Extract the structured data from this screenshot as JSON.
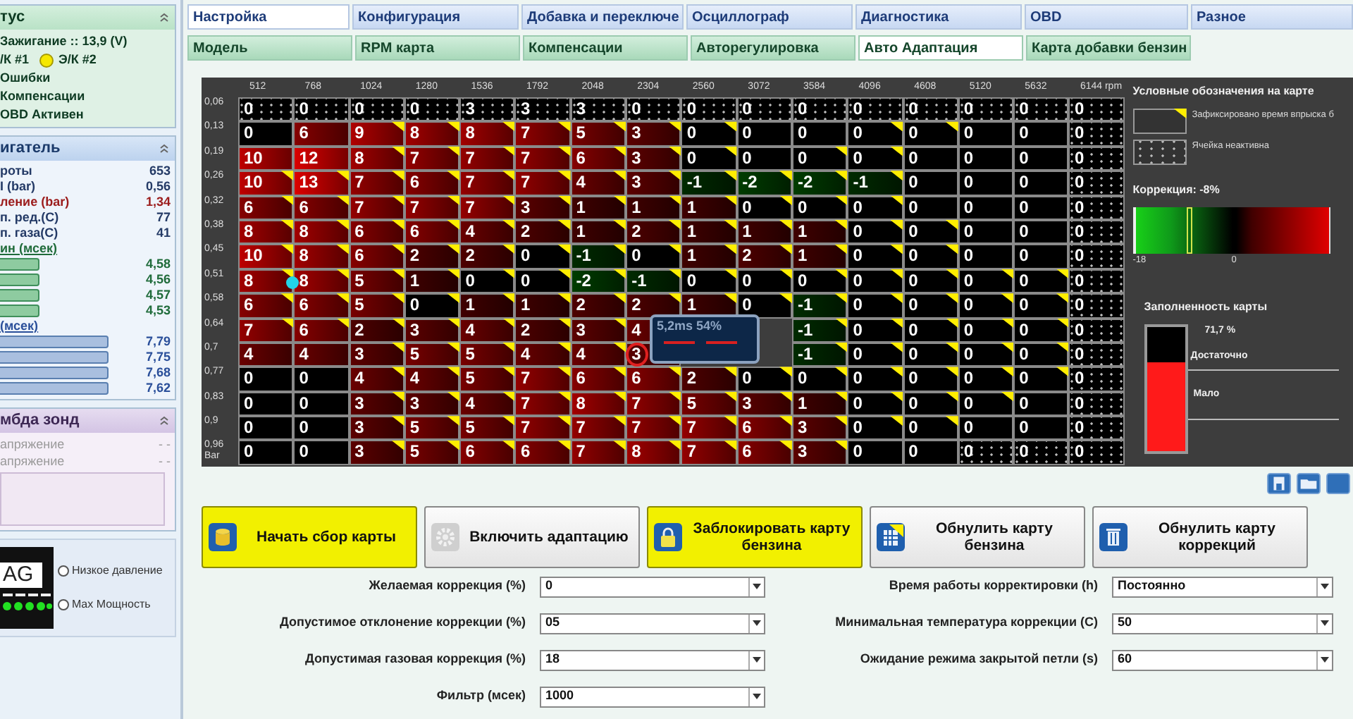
{
  "status_panel": {
    "title": "тус",
    "ignition": "Зажигание :: 13,9 (V)",
    "injectors": [
      {
        "label": "/К #1",
        "lit": false
      },
      {
        "label": "Э/К #2",
        "lit": true
      }
    ],
    "items": [
      "Ошибки",
      "Компенсации",
      "OBD Активен"
    ]
  },
  "engine_panel": {
    "title": "игатель",
    "readings": [
      {
        "label": "роты",
        "value": "653",
        "kind": "plain"
      },
      {
        "label": "I (bar)",
        "value": "0,56",
        "kind": "plain"
      },
      {
        "label": "ление (bar)",
        "value": "1,34",
        "kind": "alert"
      },
      {
        "label": "п. ред.(C)",
        "value": "77",
        "kind": "plain"
      },
      {
        "label": "п. газа(C)",
        "value": "41",
        "kind": "plain"
      }
    ],
    "gas_injection": {
      "title": "ин (мсек)",
      "values": [
        "4,58",
        "4,56",
        "4,57",
        "4,53"
      ]
    },
    "petrol_injection": {
      "title": "(мсек)",
      "values": [
        "7,79",
        "7,75",
        "7,68",
        "7,62"
      ]
    }
  },
  "lambda_panel": {
    "title": "мбда зонд",
    "rows": [
      {
        "label": "апряжение",
        "value": "- -"
      },
      {
        "label": "апряжение",
        "value": "- -"
      }
    ]
  },
  "gas_panel": {
    "logo": "AG",
    "options": [
      {
        "label": "Низкое давление",
        "selected": false
      },
      {
        "label": "Max Мощность",
        "selected": false
      }
    ]
  },
  "tabs": [
    {
      "label": "Настройка",
      "selected": true
    },
    {
      "label": "Конфигурация",
      "selected": false
    },
    {
      "label": "Добавка и переключе",
      "selected": false
    },
    {
      "label": "Осциллограф",
      "selected": false
    },
    {
      "label": "Диагностика",
      "selected": false
    },
    {
      "label": "OBD",
      "selected": false
    },
    {
      "label": "Разное",
      "selected": false
    }
  ],
  "subtabs": [
    {
      "label": "Модель",
      "selected": false
    },
    {
      "label": "RPM карта",
      "selected": false
    },
    {
      "label": "Компенсации",
      "selected": false
    },
    {
      "label": "Авторегулировка",
      "selected": false
    },
    {
      "label": "Авто Адаптация",
      "selected": true
    },
    {
      "label": "Карта добавки бензин",
      "selected": false
    }
  ],
  "map": {
    "columns": [
      "512",
      "768",
      "1024",
      "1280",
      "1536",
      "1792",
      "2048",
      "2304",
      "2560",
      "3072",
      "3584",
      "4096",
      "4608",
      "5120",
      "5632",
      "6144 rpm"
    ],
    "row_unit": "Bar",
    "rows": [
      {
        "label": "0,06",
        "cells": [
          {
            "kind": "inactive",
            "value": "0",
            "flagged": false
          },
          {
            "kind": "inactive",
            "value": "0",
            "flagged": false
          },
          {
            "kind": "inactive",
            "value": "0",
            "flagged": false
          },
          {
            "kind": "inactive",
            "value": "0",
            "flagged": false
          },
          {
            "kind": "inactive",
            "value": "3",
            "flagged": false
          },
          {
            "kind": "inactive",
            "value": "3",
            "flagged": false
          },
          {
            "kind": "inactive",
            "value": "3",
            "flagged": false
          },
          {
            "kind": "inactive",
            "value": "0",
            "flagged": false
          },
          {
            "kind": "inactive",
            "value": "0",
            "flagged": false
          },
          {
            "kind": "inactive",
            "value": "0",
            "flagged": false
          },
          {
            "kind": "inactive",
            "value": "0",
            "flagged": false
          },
          {
            "kind": "inactive",
            "value": "0",
            "flagged": false
          },
          {
            "kind": "inactive",
            "value": "0",
            "flagged": false
          },
          {
            "kind": "inactive",
            "value": "0",
            "flagged": false
          },
          {
            "kind": "inactive",
            "value": "0",
            "flagged": false
          },
          {
            "kind": "inactive",
            "value": "0",
            "flagged": false
          }
        ]
      },
      {
        "label": "0,13",
        "cells": [
          {
            "kind": "active",
            "value": "0",
            "flagged": false
          },
          {
            "kind": "active",
            "value": "6",
            "flagged": false
          },
          {
            "kind": "active",
            "value": "9",
            "flagged": true
          },
          {
            "kind": "active",
            "value": "8",
            "flagged": true
          },
          {
            "kind": "active",
            "value": "8",
            "flagged": true
          },
          {
            "kind": "active",
            "value": "7",
            "flagged": true
          },
          {
            "kind": "active",
            "value": "5",
            "flagged": true
          },
          {
            "kind": "active",
            "value": "3",
            "flagged": true
          },
          {
            "kind": "active",
            "value": "0",
            "flagged": true
          },
          {
            "kind": "active",
            "value": "0",
            "flagged": false
          },
          {
            "kind": "active",
            "value": "0",
            "flagged": false
          },
          {
            "kind": "active",
            "value": "0",
            "flagged": true
          },
          {
            "kind": "active",
            "value": "0",
            "flagged": true
          },
          {
            "kind": "active",
            "value": "0",
            "flagged": false
          },
          {
            "kind": "active",
            "value": "0",
            "flagged": false
          },
          {
            "kind": "inactive",
            "value": "0",
            "flagged": false
          }
        ]
      },
      {
        "label": "0,19",
        "cells": [
          {
            "kind": "active",
            "value": "10",
            "flagged": false
          },
          {
            "kind": "active",
            "value": "12",
            "flagged": false
          },
          {
            "kind": "active",
            "value": "8",
            "flagged": true
          },
          {
            "kind": "active",
            "value": "7",
            "flagged": true
          },
          {
            "kind": "active",
            "value": "7",
            "flagged": true
          },
          {
            "kind": "active",
            "value": "7",
            "flagged": true
          },
          {
            "kind": "active",
            "value": "6",
            "flagged": true
          },
          {
            "kind": "active",
            "value": "3",
            "flagged": true
          },
          {
            "kind": "active",
            "value": "0",
            "flagged": true
          },
          {
            "kind": "active",
            "value": "0",
            "flagged": false
          },
          {
            "kind": "active",
            "value": "0",
            "flagged": true
          },
          {
            "kind": "active",
            "value": "0",
            "flagged": true
          },
          {
            "kind": "active",
            "value": "0",
            "flagged": false
          },
          {
            "kind": "active",
            "value": "0",
            "flagged": false
          },
          {
            "kind": "active",
            "value": "0",
            "flagged": false
          },
          {
            "kind": "inactive",
            "value": "0",
            "flagged": false
          }
        ]
      },
      {
        "label": "0,26",
        "cells": [
          {
            "kind": "active",
            "value": "10",
            "flagged": true
          },
          {
            "kind": "active",
            "value": "13",
            "flagged": true
          },
          {
            "kind": "active",
            "value": "7",
            "flagged": true
          },
          {
            "kind": "active",
            "value": "6",
            "flagged": true
          },
          {
            "kind": "active",
            "value": "7",
            "flagged": true
          },
          {
            "kind": "active",
            "value": "7",
            "flagged": true
          },
          {
            "kind": "active",
            "value": "4",
            "flagged": true
          },
          {
            "kind": "active",
            "value": "3",
            "flagged": true
          },
          {
            "kind": "active",
            "value": "-1",
            "flagged": true
          },
          {
            "kind": "active",
            "value": "-2",
            "flagged": true
          },
          {
            "kind": "active",
            "value": "-2",
            "flagged": true
          },
          {
            "kind": "active",
            "value": "-1",
            "flagged": true
          },
          {
            "kind": "active",
            "value": "0",
            "flagged": false
          },
          {
            "kind": "active",
            "value": "0",
            "flagged": false
          },
          {
            "kind": "active",
            "value": "0",
            "flagged": false
          },
          {
            "kind": "inactive",
            "value": "0",
            "flagged": false
          }
        ]
      },
      {
        "label": "0,32",
        "cells": [
          {
            "kind": "active",
            "value": "6",
            "flagged": true
          },
          {
            "kind": "active",
            "value": "6",
            "flagged": true
          },
          {
            "kind": "active",
            "value": "7",
            "flagged": true
          },
          {
            "kind": "active",
            "value": "7",
            "flagged": true
          },
          {
            "kind": "active",
            "value": "7",
            "flagged": true
          },
          {
            "kind": "active",
            "value": "3",
            "flagged": true
          },
          {
            "kind": "active",
            "value": "1",
            "flagged": true
          },
          {
            "kind": "active",
            "value": "1",
            "flagged": true
          },
          {
            "kind": "active",
            "value": "1",
            "flagged": true
          },
          {
            "kind": "active",
            "value": "0",
            "flagged": true
          },
          {
            "kind": "active",
            "value": "0",
            "flagged": true
          },
          {
            "kind": "active",
            "value": "0",
            "flagged": true
          },
          {
            "kind": "active",
            "value": "0",
            "flagged": false
          },
          {
            "kind": "active",
            "value": "0",
            "flagged": false
          },
          {
            "kind": "active",
            "value": "0",
            "flagged": false
          },
          {
            "kind": "inactive",
            "value": "0",
            "flagged": false
          }
        ]
      },
      {
        "label": "0,38",
        "cells": [
          {
            "kind": "active",
            "value": "8",
            "flagged": true
          },
          {
            "kind": "active",
            "value": "8",
            "flagged": true
          },
          {
            "kind": "active",
            "value": "6",
            "flagged": true
          },
          {
            "kind": "active",
            "value": "6",
            "flagged": true
          },
          {
            "kind": "active",
            "value": "4",
            "flagged": true
          },
          {
            "kind": "active",
            "value": "2",
            "flagged": true
          },
          {
            "kind": "active",
            "value": "1",
            "flagged": true
          },
          {
            "kind": "active",
            "value": "2",
            "flagged": true
          },
          {
            "kind": "active",
            "value": "1",
            "flagged": true
          },
          {
            "kind": "active",
            "value": "1",
            "flagged": true
          },
          {
            "kind": "active",
            "value": "1",
            "flagged": true
          },
          {
            "kind": "active",
            "value": "0",
            "flagged": true
          },
          {
            "kind": "active",
            "value": "0",
            "flagged": true
          },
          {
            "kind": "active",
            "value": "0",
            "flagged": false
          },
          {
            "kind": "active",
            "value": "0",
            "flagged": false
          },
          {
            "kind": "inactive",
            "value": "0",
            "flagged": false
          }
        ]
      },
      {
        "label": "0,45",
        "cells": [
          {
            "kind": "active",
            "value": "10",
            "flagged": true
          },
          {
            "kind": "active",
            "value": "8",
            "flagged": true
          },
          {
            "kind": "active",
            "value": "6",
            "flagged": true
          },
          {
            "kind": "active",
            "value": "2",
            "flagged": true
          },
          {
            "kind": "active",
            "value": "2",
            "flagged": true
          },
          {
            "kind": "active",
            "value": "0",
            "flagged": true
          },
          {
            "kind": "active",
            "value": "-1",
            "flagged": true
          },
          {
            "kind": "active",
            "value": "0",
            "flagged": true
          },
          {
            "kind": "active",
            "value": "1",
            "flagged": true
          },
          {
            "kind": "active",
            "value": "2",
            "flagged": true
          },
          {
            "kind": "active",
            "value": "1",
            "flagged": true
          },
          {
            "kind": "active",
            "value": "0",
            "flagged": true
          },
          {
            "kind": "active",
            "value": "0",
            "flagged": true
          },
          {
            "kind": "active",
            "value": "0",
            "flagged": false
          },
          {
            "kind": "active",
            "value": "0",
            "flagged": false
          },
          {
            "kind": "inactive",
            "value": "0",
            "flagged": false
          }
        ]
      },
      {
        "label": "0,51",
        "cells": [
          {
            "kind": "dotted",
            "value": "8",
            "flagged": true
          },
          {
            "kind": "active",
            "value": "8",
            "flagged": true
          },
          {
            "kind": "active",
            "value": "5",
            "flagged": true
          },
          {
            "kind": "active",
            "value": "1",
            "flagged": true
          },
          {
            "kind": "active",
            "value": "0",
            "flagged": true
          },
          {
            "kind": "active",
            "value": "0",
            "flagged": true
          },
          {
            "kind": "active",
            "value": "-2",
            "flagged": true
          },
          {
            "kind": "active",
            "value": "-1",
            "flagged": true
          },
          {
            "kind": "active",
            "value": "0",
            "flagged": true
          },
          {
            "kind": "active",
            "value": "0",
            "flagged": true
          },
          {
            "kind": "active",
            "value": "0",
            "flagged": true
          },
          {
            "kind": "active",
            "value": "0",
            "flagged": true
          },
          {
            "kind": "active",
            "value": "0",
            "flagged": true
          },
          {
            "kind": "active",
            "value": "0",
            "flagged": true
          },
          {
            "kind": "active",
            "value": "0",
            "flagged": true
          },
          {
            "kind": "inactive",
            "value": "0",
            "flagged": false
          }
        ]
      },
      {
        "label": "0,58",
        "cells": [
          {
            "kind": "active",
            "value": "6",
            "flagged": true
          },
          {
            "kind": "active",
            "value": "6",
            "flagged": true
          },
          {
            "kind": "active",
            "value": "5",
            "flagged": true
          },
          {
            "kind": "active",
            "value": "0",
            "flagged": true
          },
          {
            "kind": "active",
            "value": "1",
            "flagged": true
          },
          {
            "kind": "active",
            "value": "1",
            "flagged": true
          },
          {
            "kind": "active",
            "value": "2",
            "flagged": true
          },
          {
            "kind": "active",
            "value": "2",
            "flagged": true
          },
          {
            "kind": "active",
            "value": "1",
            "flagged": true
          },
          {
            "kind": "active",
            "value": "0",
            "flagged": true
          },
          {
            "kind": "active",
            "value": "-1",
            "flagged": true
          },
          {
            "kind": "active",
            "value": "0",
            "flagged": true
          },
          {
            "kind": "active",
            "value": "0",
            "flagged": true
          },
          {
            "kind": "active",
            "value": "0",
            "flagged": true
          },
          {
            "kind": "active",
            "value": "0",
            "flagged": true
          },
          {
            "kind": "inactive",
            "value": "0",
            "flagged": false
          }
        ]
      },
      {
        "label": "0,64",
        "cells": [
          {
            "kind": "active",
            "value": "7",
            "flagged": true
          },
          {
            "kind": "active",
            "value": "6",
            "flagged": true
          },
          {
            "kind": "active",
            "value": "2",
            "flagged": true
          },
          {
            "kind": "active",
            "value": "3",
            "flagged": true
          },
          {
            "kind": "active",
            "value": "4",
            "flagged": true
          },
          {
            "kind": "active",
            "value": "2",
            "flagged": true
          },
          {
            "kind": "active",
            "value": "3",
            "flagged": true
          },
          {
            "kind": "active",
            "value": "4",
            "flagged": false
          },
          {
            "kind": "covered"
          },
          {
            "kind": "covered"
          },
          {
            "kind": "active",
            "value": "-1",
            "flagged": true
          },
          {
            "kind": "active",
            "value": "0",
            "flagged": true
          },
          {
            "kind": "active",
            "value": "0",
            "flagged": true
          },
          {
            "kind": "active",
            "value": "0",
            "flagged": true
          },
          {
            "kind": "active",
            "value": "0",
            "flagged": true
          },
          {
            "kind": "inactive",
            "value": "0",
            "flagged": false
          }
        ]
      },
      {
        "label": "0,7",
        "cells": [
          {
            "kind": "active",
            "value": "4",
            "flagged": false
          },
          {
            "kind": "active",
            "value": "4",
            "flagged": false
          },
          {
            "kind": "active",
            "value": "3",
            "flagged": true
          },
          {
            "kind": "active",
            "value": "5",
            "flagged": true
          },
          {
            "kind": "active",
            "value": "5",
            "flagged": true
          },
          {
            "kind": "active",
            "value": "4",
            "flagged": true
          },
          {
            "kind": "active",
            "value": "4",
            "flagged": true
          },
          {
            "kind": "circled",
            "value": "3",
            "flagged": false
          },
          {
            "kind": "covered"
          },
          {
            "kind": "covered"
          },
          {
            "kind": "active",
            "value": "-1",
            "flagged": true
          },
          {
            "kind": "active",
            "value": "0",
            "flagged": true
          },
          {
            "kind": "active",
            "value": "0",
            "flagged": true
          },
          {
            "kind": "active",
            "value": "0",
            "flagged": true
          },
          {
            "kind": "active",
            "value": "0",
            "flagged": true
          },
          {
            "kind": "inactive",
            "value": "0",
            "flagged": false
          }
        ]
      },
      {
        "label": "0,77",
        "cells": [
          {
            "kind": "active",
            "value": "0",
            "flagged": false
          },
          {
            "kind": "active",
            "value": "0",
            "flagged": false
          },
          {
            "kind": "active",
            "value": "4",
            "flagged": true
          },
          {
            "kind": "active",
            "value": "4",
            "flagged": true
          },
          {
            "kind": "active",
            "value": "5",
            "flagged": true
          },
          {
            "kind": "active",
            "value": "7",
            "flagged": true
          },
          {
            "kind": "active",
            "value": "6",
            "flagged": true
          },
          {
            "kind": "active",
            "value": "6",
            "flagged": true
          },
          {
            "kind": "active",
            "value": "2",
            "flagged": true
          },
          {
            "kind": "active",
            "value": "0",
            "flagged": true
          },
          {
            "kind": "active",
            "value": "0",
            "flagged": true
          },
          {
            "kind": "active",
            "value": "0",
            "flagged": true
          },
          {
            "kind": "active",
            "value": "0",
            "flagged": true
          },
          {
            "kind": "active",
            "value": "0",
            "flagged": true
          },
          {
            "kind": "active",
            "value": "0",
            "flagged": true
          },
          {
            "kind": "inactive",
            "value": "0",
            "flagged": false
          }
        ]
      },
      {
        "label": "0,83",
        "cells": [
          {
            "kind": "active",
            "value": "0",
            "flagged": false
          },
          {
            "kind": "active",
            "value": "0",
            "flagged": false
          },
          {
            "kind": "active",
            "value": "3",
            "flagged": true
          },
          {
            "kind": "active",
            "value": "3",
            "flagged": true
          },
          {
            "kind": "active",
            "value": "4",
            "flagged": true
          },
          {
            "kind": "active",
            "value": "7",
            "flagged": true
          },
          {
            "kind": "active",
            "value": "8",
            "flagged": true
          },
          {
            "kind": "active",
            "value": "7",
            "flagged": true
          },
          {
            "kind": "active",
            "value": "5",
            "flagged": true
          },
          {
            "kind": "active",
            "value": "3",
            "flagged": true
          },
          {
            "kind": "active",
            "value": "1",
            "flagged": true
          },
          {
            "kind": "active",
            "value": "0",
            "flagged": true
          },
          {
            "kind": "active",
            "value": "0",
            "flagged": true
          },
          {
            "kind": "active",
            "value": "0",
            "flagged": true
          },
          {
            "kind": "active",
            "value": "0",
            "flagged": false
          },
          {
            "kind": "inactive",
            "value": "0",
            "flagged": false
          }
        ]
      },
      {
        "label": "0,9",
        "cells": [
          {
            "kind": "active",
            "value": "0",
            "flagged": false
          },
          {
            "kind": "active",
            "value": "0",
            "flagged": false
          },
          {
            "kind": "active",
            "value": "3",
            "flagged": true
          },
          {
            "kind": "active",
            "value": "5",
            "flagged": true
          },
          {
            "kind": "active",
            "value": "5",
            "flagged": true
          },
          {
            "kind": "active",
            "value": "7",
            "flagged": true
          },
          {
            "kind": "active",
            "value": "7",
            "flagged": true
          },
          {
            "kind": "active",
            "value": "7",
            "flagged": true
          },
          {
            "kind": "active",
            "value": "7",
            "flagged": true
          },
          {
            "kind": "active",
            "value": "6",
            "flagged": true
          },
          {
            "kind": "active",
            "value": "3",
            "flagged": true
          },
          {
            "kind": "active",
            "value": "0",
            "flagged": true
          },
          {
            "kind": "active",
            "value": "0",
            "flagged": true
          },
          {
            "kind": "active",
            "value": "0",
            "flagged": false
          },
          {
            "kind": "active",
            "value": "0",
            "flagged": false
          },
          {
            "kind": "inactive",
            "value": "0",
            "flagged": false
          }
        ]
      },
      {
        "label": "0,96",
        "cells": [
          {
            "kind": "active",
            "value": "0",
            "flagged": false
          },
          {
            "kind": "active",
            "value": "0",
            "flagged": false
          },
          {
            "kind": "active",
            "value": "3",
            "flagged": true
          },
          {
            "kind": "active",
            "value": "5",
            "flagged": true
          },
          {
            "kind": "active",
            "value": "6",
            "flagged": true
          },
          {
            "kind": "active",
            "value": "6",
            "flagged": true
          },
          {
            "kind": "active",
            "value": "7",
            "flagged": true
          },
          {
            "kind": "active",
            "value": "8",
            "flagged": true
          },
          {
            "kind": "active",
            "value": "7",
            "flagged": true
          },
          {
            "kind": "active",
            "value": "6",
            "flagged": true
          },
          {
            "kind": "active",
            "value": "3",
            "flagged": true
          },
          {
            "kind": "active",
            "value": "0",
            "flagged": false
          },
          {
            "kind": "active",
            "value": "0",
            "flagged": false
          },
          {
            "kind": "inactive",
            "value": "0",
            "flagged": false
          },
          {
            "kind": "inactive",
            "value": "0",
            "flagged": false
          },
          {
            "kind": "inactive",
            "value": "0",
            "flagged": false
          }
        ]
      }
    ],
    "tooltip": "5,2ms 54%"
  },
  "legend": {
    "title": "Условные обозначения на карте",
    "items": [
      {
        "kind": "flagged",
        "label": "Зафиксировано время впрыска б"
      },
      {
        "kind": "inactive",
        "label": "Ячейка неактивна"
      }
    ],
    "correction": {
      "title": "Коррекция: -8%",
      "level": 0.28,
      "scale": [
        "-18",
        "0"
      ]
    },
    "fill": {
      "title": "Заполненность карты",
      "reading": "71,7 %",
      "level": 0.717,
      "high_label": "Достаточно",
      "low_label": "Мало"
    }
  },
  "buttons": [
    {
      "label": "Начать сбор карты",
      "active": true
    },
    {
      "label": "Включить адаптацию",
      "active": false
    },
    {
      "label": "Заблокировать карту бензина",
      "active": true
    },
    {
      "label": "Обнулить карту бензина",
      "active": false
    },
    {
      "label": "Обнулить карту коррекций",
      "active": false
    }
  ],
  "fields_left": [
    {
      "label": "Желаемая коррекция (%)",
      "value": "0"
    },
    {
      "label": "Допустимое отклонение коррекции (%)",
      "value": "05"
    },
    {
      "label": "Допустимая газовая коррекция (%)",
      "value": "18"
    },
    {
      "label": "Фильтр (мсек)",
      "value": "1000"
    }
  ],
  "fields_right": [
    {
      "label": "Время работы корректировки (h)",
      "value": "Постоянно"
    },
    {
      "label": "Минимальная температура коррекции (C)",
      "value": "50"
    },
    {
      "label": "Ожидание режима закрытой петли (s)",
      "value": "60"
    }
  ]
}
